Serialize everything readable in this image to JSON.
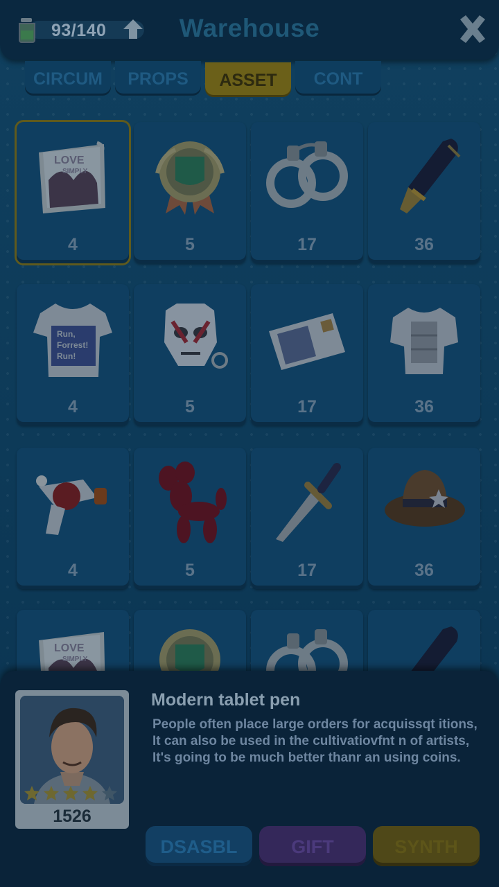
{
  "header": {
    "capacity": "93/140",
    "title": "Warehouse"
  },
  "tabs": [
    {
      "label": "CIRCUM"
    },
    {
      "label": "PROPS"
    },
    {
      "label": "ASSET",
      "active": true
    },
    {
      "label": "CONT"
    }
  ],
  "items": [
    {
      "name": "love-simply-poster",
      "qty": "4"
    },
    {
      "name": "medal-badge",
      "qty": "5"
    },
    {
      "name": "handcuffs",
      "qty": "17"
    },
    {
      "name": "fountain-pen",
      "qty": "36"
    },
    {
      "name": "forrest-tshirt",
      "qty": "4"
    },
    {
      "name": "white-mask",
      "qty": "5"
    },
    {
      "name": "postcard",
      "qty": "17"
    },
    {
      "name": "armor-vest",
      "qty": "36"
    },
    {
      "name": "ray-gun",
      "qty": "4"
    },
    {
      "name": "balloon-dog",
      "qty": "5"
    },
    {
      "name": "dagger",
      "qty": "17"
    },
    {
      "name": "cowboy-hat",
      "qty": "36"
    }
  ],
  "detail": {
    "name": "Modern tablet pen",
    "description": "People often place large orders for acquissqt itions, It can also be used in the cultivatiovfnt n of artists, It's going to be much better thanr an using coins.",
    "character_value": "1526",
    "stars": 5
  },
  "buttons": {
    "dismantle": "DSASBL",
    "gift": "GIFT",
    "synth": "SYNTH"
  }
}
